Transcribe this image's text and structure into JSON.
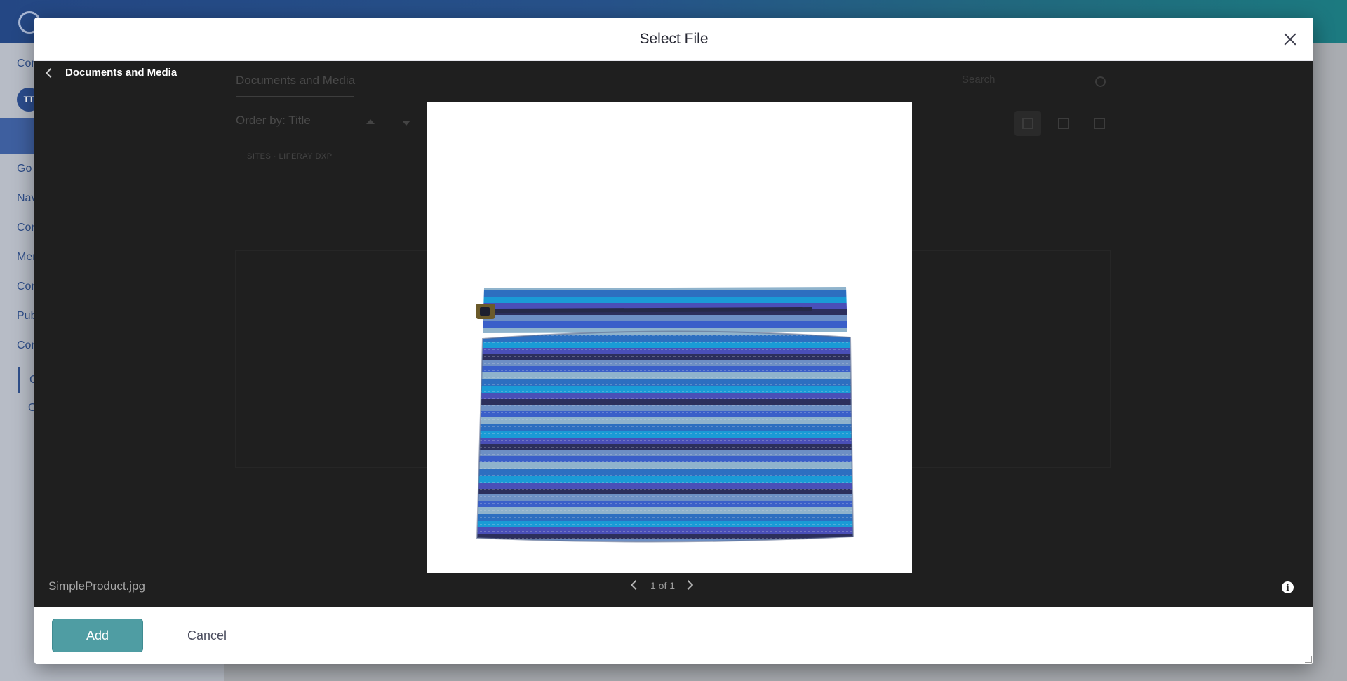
{
  "background": {
    "sidebar_items": [
      "Con",
      "Go t",
      "Nav",
      "Con",
      "Men",
      "Con",
      "Pub",
      "Con",
      "C",
      "O"
    ],
    "avatar_initials": "TT"
  },
  "modal": {
    "title": "Select File",
    "back_label": "Documents and Media",
    "underlying": {
      "tab_label": "Documents and Media",
      "search_placeholder": "Search",
      "order_by_label": "Order by: Title",
      "breadcrumb": "SITES  ·  LIFERAY DXP"
    },
    "preview": {
      "file_name": "SimpleProduct.jpg",
      "pagination": "1 of 1"
    },
    "footer": {
      "add_label": "Add",
      "cancel_label": "Cancel"
    }
  },
  "colors": {
    "accent": "#4f9da3",
    "viewer_background": "#1f1f1f"
  },
  "icons": [
    "close-icon",
    "chevron-left-icon",
    "chevron-right-icon",
    "info-icon",
    "search-icon"
  ]
}
